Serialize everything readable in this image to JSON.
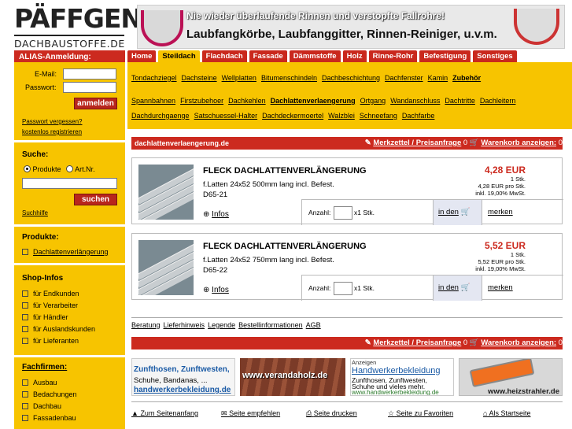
{
  "header": {
    "logo_main": "PÄFFGEN",
    "logo_sub": "DACHBAUSTOFFE.DE",
    "banner_line1": "Nie wieder überlaufende Rinnen und verstopfte Fallrohre!",
    "banner_line2": "Laubfangkörbe, Laubfanggitter, Rinnen-Reiniger, u.v.m."
  },
  "sidebar": {
    "login_title": "ALIAS-Anmeldung:",
    "email_label": "E-Mail:",
    "password_label": "Passwort:",
    "login_button": "anmelden",
    "forgot_link": "Passwort vergessen?",
    "register_link": "kostenlos registrieren",
    "search_title": "Suche:",
    "radio_products": "Produkte",
    "radio_artnr": "Art.Nr.",
    "search_button": "suchen",
    "search_help": "Suchhilfe",
    "products_title": "Produkte:",
    "products_item": "Dachlattenverlängerung",
    "shopinfos_title": "Shop-Infos",
    "shopinfos": [
      "für Endkunden",
      "für Verarbeiter",
      "für Händler",
      "für Auslandskunden",
      "für Lieferanten"
    ],
    "fachfirmen_title": "Fachfirmen:",
    "fachfirmen": [
      "Ausbau",
      "Bedachungen",
      "Dachbau",
      "Fassadenbau"
    ]
  },
  "tabs": [
    "Home",
    "Steildach",
    "Flachdach",
    "Fassade",
    "Dämmstoffe",
    "Holz",
    "Rinne-Rohr",
    "Befestigung",
    "Sonstiges"
  ],
  "subnav": {
    "row1": [
      "Tondachziegel",
      "Dachsteine",
      "Wellplatten",
      "Bitumenschindeln",
      "Dachbeschichtung",
      "Dachfenster",
      "Kamin",
      "Zubehör"
    ],
    "row2": [
      "Spannbahnen",
      "Firstzubehoer",
      "Dachkehlen",
      "Dachlattenverlaengerung",
      "Ortgang",
      "Wandanschluss",
      "Dachtritte",
      "Dachleitern"
    ],
    "row3": [
      "Dachdurchgaenge",
      "Satschuessel-Halter",
      "Dachdeckermoertel",
      "Walzblei",
      "Schneefang",
      "Dachfarbe"
    ]
  },
  "content": {
    "breadcrumb": "dachlattenverlaengerung.de",
    "merkzettel": "Merkzettel / Preisanfrage",
    "merkzettel_count": "0",
    "warenkorb": "Warenkorb anzeigen:",
    "warenkorb_count": "0",
    "products": [
      {
        "title": "FLECK DACHLATTENVERLÄNGERUNG",
        "desc1": "f.Latten 24x52 500mm lang incl. Befest.",
        "artnr": "D65-21",
        "price": "4,28 EUR",
        "unit": "1 Stk.",
        "per": "4,28 EUR pro Stk.",
        "vat": "inkl. 19,00% MwSt.",
        "infos": "Infos",
        "anzahl": "Anzahl:",
        "qty_unit": "x1 Stk.",
        "add": "in den",
        "memo": "merken"
      },
      {
        "title": "FLECK DACHLATTENVERLÄNGERUNG",
        "desc1": "f.Latten 24x52 750mm lang incl. Befest.",
        "artnr": "D65-22",
        "price": "5,52 EUR",
        "unit": "1 Stk.",
        "per": "5,52 EUR pro Stk.",
        "vat": "inkl. 19,00% MwSt.",
        "infos": "Infos",
        "anzahl": "Anzahl:",
        "qty_unit": "x1 Stk.",
        "add": "in den",
        "memo": "merken"
      }
    ],
    "footer_links": [
      "Beratung",
      "Lieferhinweis",
      "Legende",
      "Bestellinformationen",
      "AGB"
    ]
  },
  "ads": {
    "ad1_l1": "Zunfthosen, Zunftwesten,",
    "ad1_l2": "Schuhe, Bandanas, ...",
    "ad1_l3": "handwerkerbekleidung.de",
    "ad2": "www.verandaholz.de",
    "ad3_tag": "Anzeigen",
    "ad3_title": "Handwerkerbekleidung",
    "ad3_l1": "Zunfthosen, Zunftwesten,",
    "ad3_l2": "Schuhe und vieles mehr.",
    "ad3_url": "www.handwerkerbekleidung.de",
    "ad4": "www.heizstrahler.de"
  },
  "bottom": {
    "top": "Zum Seitenanfang",
    "recommend": "Seite empfehlen",
    "print": "Seite drucken",
    "favorites": "Seite zu Favoriten",
    "home": "Als Startseite"
  },
  "colors": {
    "accent": "#cc2a1f",
    "brand_yellow": "#f7c400"
  }
}
